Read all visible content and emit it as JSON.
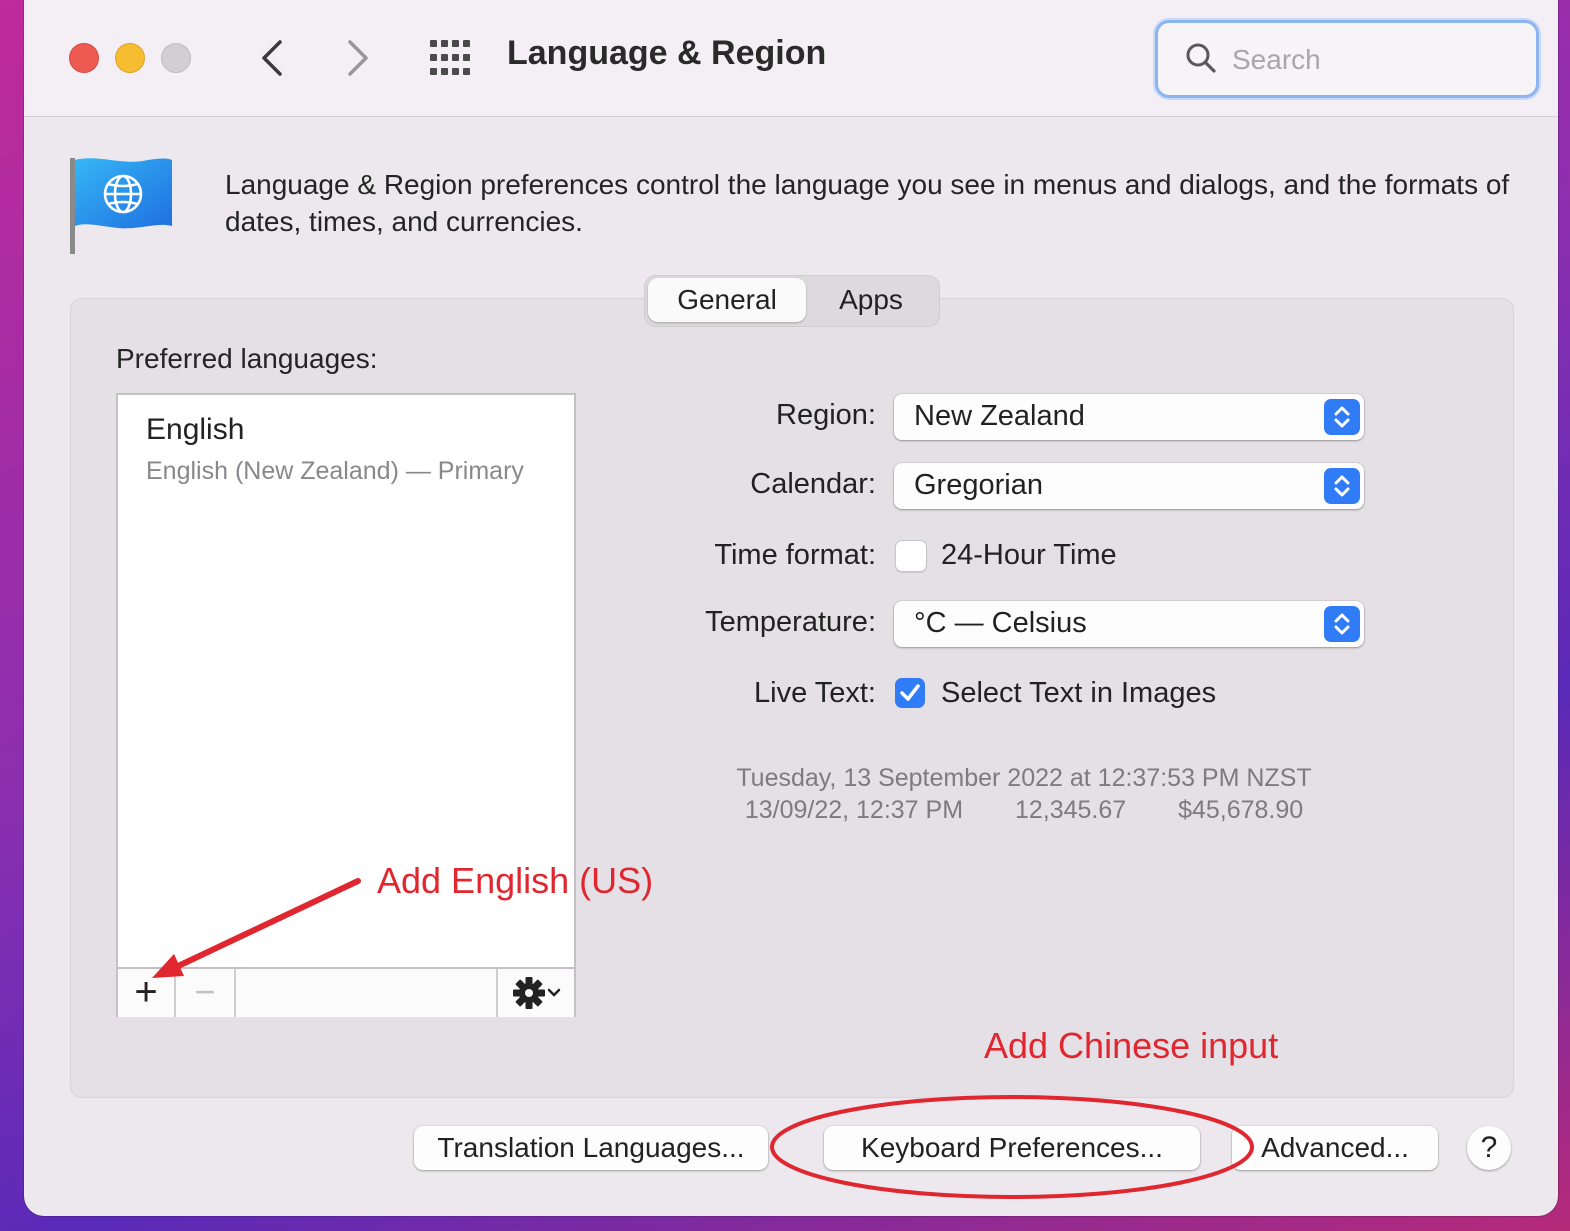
{
  "window": {
    "title": "Language & Region",
    "search_placeholder": "Search"
  },
  "header": {
    "description": "Language & Region preferences control the language you see in menus and dialogs, and the formats of dates, times, and currencies."
  },
  "tabs": [
    {
      "label": "General",
      "selected": true
    },
    {
      "label": "Apps",
      "selected": false
    }
  ],
  "preferred_languages": {
    "label": "Preferred languages:",
    "items": [
      {
        "name": "English",
        "detail": "English (New Zealand) — Primary"
      }
    ],
    "add_symbol": "+",
    "remove_symbol": "−"
  },
  "settings": {
    "region": {
      "label": "Region:",
      "value": "New Zealand"
    },
    "calendar": {
      "label": "Calendar:",
      "value": "Gregorian"
    },
    "time_format": {
      "label": "Time format:",
      "checkbox_label": "24-Hour Time",
      "checked": false
    },
    "temperature": {
      "label": "Temperature:",
      "value": "°C — Celsius"
    },
    "live_text": {
      "label": "Live Text:",
      "checkbox_label": "Select Text in Images",
      "checked": true
    }
  },
  "sample": {
    "long_date": "Tuesday, 13 September 2022 at 12:37:53 PM NZST",
    "short_date": "13/09/22, 12:37 PM",
    "number": "12,345.67",
    "currency": "$45,678.90"
  },
  "buttons": {
    "translation": "Translation Languages...",
    "keyboard": "Keyboard Preferences...",
    "advanced": "Advanced...",
    "help": "?"
  },
  "annotations": {
    "add_english": "Add English (US)",
    "add_chinese": "Add Chinese input"
  },
  "colors": {
    "accent": "#2f7cf6",
    "annotation": "#e0262e",
    "close": "#ee5a52",
    "minimize": "#f5bd2f"
  }
}
